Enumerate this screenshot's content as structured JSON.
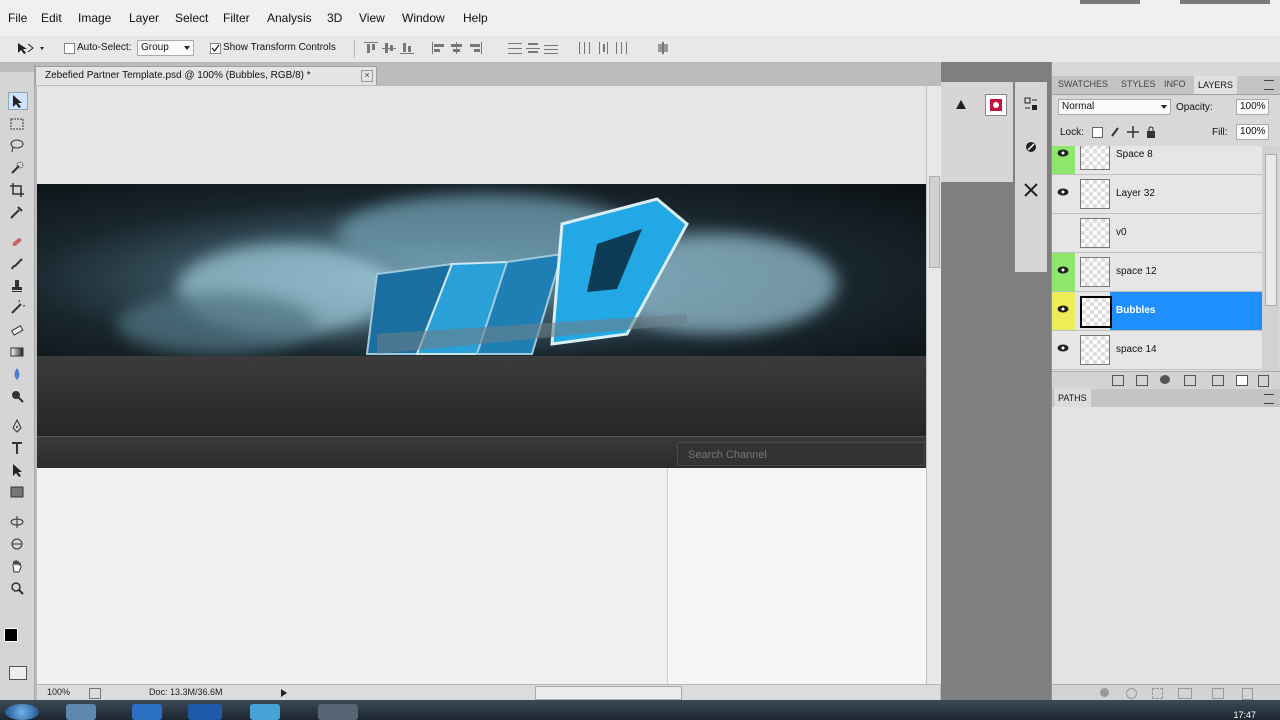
{
  "menu": [
    "File",
    "Edit",
    "Image",
    "Layer",
    "Select",
    "Filter",
    "Analysis",
    "3D",
    "View",
    "Window",
    "Help"
  ],
  "options_bar": {
    "auto_select_label": "Auto-Select:",
    "auto_select_value": "Group",
    "show_transform_label": "Show Transform Controls"
  },
  "document": {
    "tab_title": "Zebefied Partner Template.psd @ 100% (Bubbles, RGB/8) *",
    "search_placeholder": "Search Channel"
  },
  "status_bar": {
    "zoom": "100%",
    "doc_size": "Doc: 13.3M/36.6M"
  },
  "panels": {
    "tabs": [
      "SWATCHES",
      "STYLES",
      "INFO",
      "LAYERS"
    ],
    "active_tab": "LAYERS",
    "blend_mode": "Normal",
    "opacity_label": "Opacity:",
    "opacity_value": "100%",
    "lock_label": "Lock:",
    "fill_label": "Fill:",
    "fill_value": "100%",
    "layers": [
      {
        "name": "Space 8",
        "eye": "green",
        "visible": true,
        "selected": false
      },
      {
        "name": "Layer 32",
        "eye": "none",
        "visible": true,
        "selected": false
      },
      {
        "name": "v0",
        "eye": "none",
        "visible": false,
        "selected": false
      },
      {
        "name": "space 12",
        "eye": "green",
        "visible": true,
        "selected": false
      },
      {
        "name": "Bubbles",
        "eye": "yellow",
        "visible": true,
        "selected": true
      },
      {
        "name": "space 14",
        "eye": "none",
        "visible": true,
        "selected": false
      }
    ],
    "paths_label": "PATHS"
  },
  "taskbar": {
    "clock": "17:47"
  },
  "colors": {
    "selected_layer": "#1f8fff",
    "eye_green": "#8ee66c",
    "eye_yellow": "#eded58"
  }
}
